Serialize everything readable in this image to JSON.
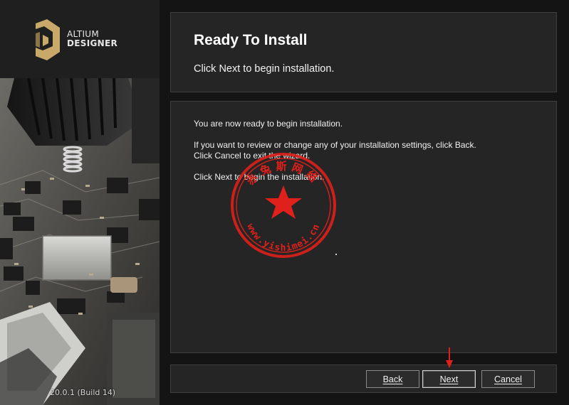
{
  "brand": {
    "name_line1": "ALTIUM",
    "name_line2": "DESIGNER",
    "version": "20.0.1 (Build 14)",
    "accent_color": "#c9a96a"
  },
  "header": {
    "title": "Ready To Install",
    "subtitle": "Click Next to begin installation."
  },
  "body": {
    "line1": "You are now ready to begin installation.",
    "line2": "If you want to review or change any of your installation settings, click Back.",
    "line3": "Click Cancel to exit the wizard.",
    "line4": "Click Next to begin the installation."
  },
  "buttons": {
    "back": "Back",
    "next": "Next",
    "cancel": "Cancel"
  },
  "watermark": {
    "top_text": "赤兔斯网络",
    "bottom_text": "www.yishimei.cn",
    "color": "#e0201b"
  },
  "annotation": {
    "arrow_color": "#e0201b"
  }
}
